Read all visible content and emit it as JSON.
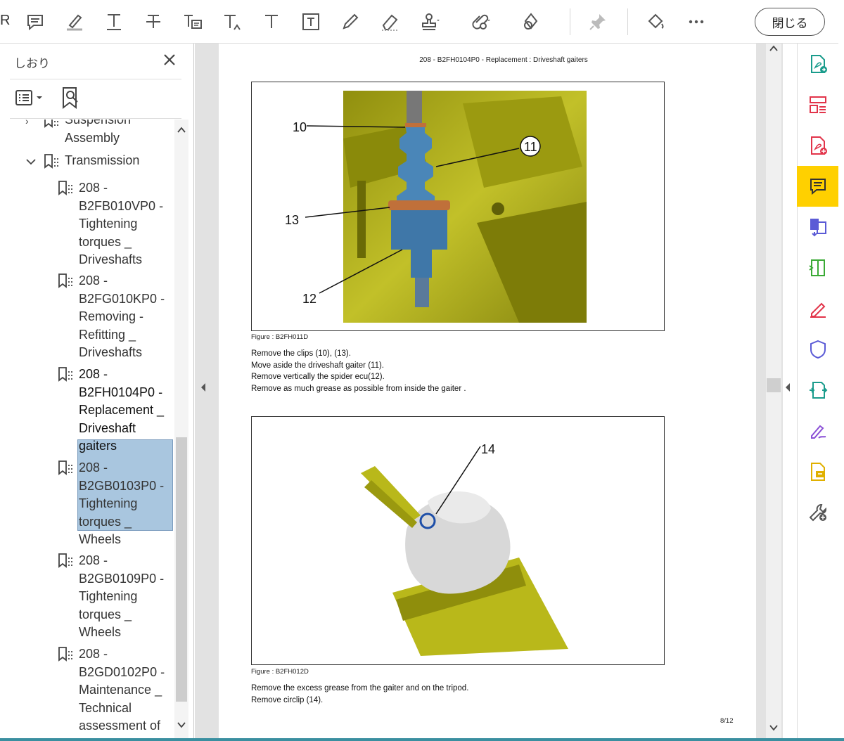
{
  "toolbar": {
    "cut_label": "R",
    "close_label": "閉じる",
    "tools": [
      {
        "name": "comment-icon"
      },
      {
        "name": "highlight-icon"
      },
      {
        "name": "underline-text-icon"
      },
      {
        "name": "strikethrough-icon"
      },
      {
        "name": "replace-text-icon"
      },
      {
        "name": "insert-text-icon"
      },
      {
        "name": "add-text-icon"
      },
      {
        "name": "text-box-icon"
      },
      {
        "name": "pencil-icon"
      },
      {
        "name": "eraser-icon"
      },
      {
        "name": "stamp-icon"
      },
      {
        "name": "attach-file-icon"
      },
      {
        "name": "shapes-icon"
      },
      {
        "name": "pin-icon"
      },
      {
        "name": "fill-icon"
      },
      {
        "name": "more-icon"
      }
    ]
  },
  "bookmarks": {
    "title": "しおり",
    "items": [
      {
        "level": 1,
        "lines": [
          "Suspension",
          "Assembly"
        ],
        "expanded": false
      },
      {
        "level": 1,
        "lines": [
          "Transmission"
        ],
        "expanded": true
      },
      {
        "level": 2,
        "lines": [
          "208 -",
          "B2FB010VP0 -",
          "Tightening",
          "torques _",
          "Driveshafts"
        ]
      },
      {
        "level": 2,
        "lines": [
          "208 -",
          "B2FG010KP0 -",
          "Removing -",
          "Refitting _",
          "Driveshafts"
        ]
      },
      {
        "level": 2,
        "lines": [
          "208 -",
          "B2FH0104P0 -",
          "Replacement _",
          "Driveshaft",
          "gaiters"
        ],
        "selected": true
      },
      {
        "level": 2,
        "lines": [
          "208 -",
          "B2GB0103P0 -",
          "Tightening",
          "torques _",
          "Wheels"
        ]
      },
      {
        "level": 2,
        "lines": [
          "208 -",
          "B2GB0109P0 -",
          "Tightening",
          "torques _",
          "Wheels"
        ]
      },
      {
        "level": 2,
        "lines": [
          "208 -",
          "B2GD0102P0 -",
          "Maintenance _",
          "Technical",
          "assessment of"
        ]
      }
    ]
  },
  "document": {
    "header": "208 - B2FH0104P0 - Replacement : Driveshaft gaiters",
    "figure1": {
      "caption": "Figure : B2FH011D",
      "callouts": [
        "10",
        "11",
        "13",
        "12"
      ]
    },
    "steps1": [
      "Remove the clips (10), (13).",
      "Move aside the driveshaft gaiter (11).",
      "Remove vertically the spider ecu(12).",
      "Remove as much grease as possible from inside the gaiter ."
    ],
    "figure2": {
      "caption": "Figure : B2FH012D",
      "callouts": [
        "14"
      ]
    },
    "steps2": [
      "Remove the excess grease from the gaiter and on the tripod.",
      "Remove circlip (14)."
    ],
    "page_number": "8/12"
  },
  "colors": {
    "selection": "#a9c6df",
    "rail_active": "#ffd000",
    "vise_yellow": "#b9b81a",
    "gaiter_blue": "#4a86b8"
  },
  "right_rail": [
    {
      "name": "export-pdf-icon"
    },
    {
      "name": "organize-pages-icon"
    },
    {
      "name": "create-pdf-icon"
    },
    {
      "name": "comment-tool-icon",
      "active": true
    },
    {
      "name": "combine-files-icon"
    },
    {
      "name": "compress-icon"
    },
    {
      "name": "fill-sign-icon"
    },
    {
      "name": "protect-icon"
    },
    {
      "name": "send-track-icon"
    },
    {
      "name": "sign-icon"
    },
    {
      "name": "rich-media-icon"
    },
    {
      "name": "more-tools-icon"
    }
  ]
}
